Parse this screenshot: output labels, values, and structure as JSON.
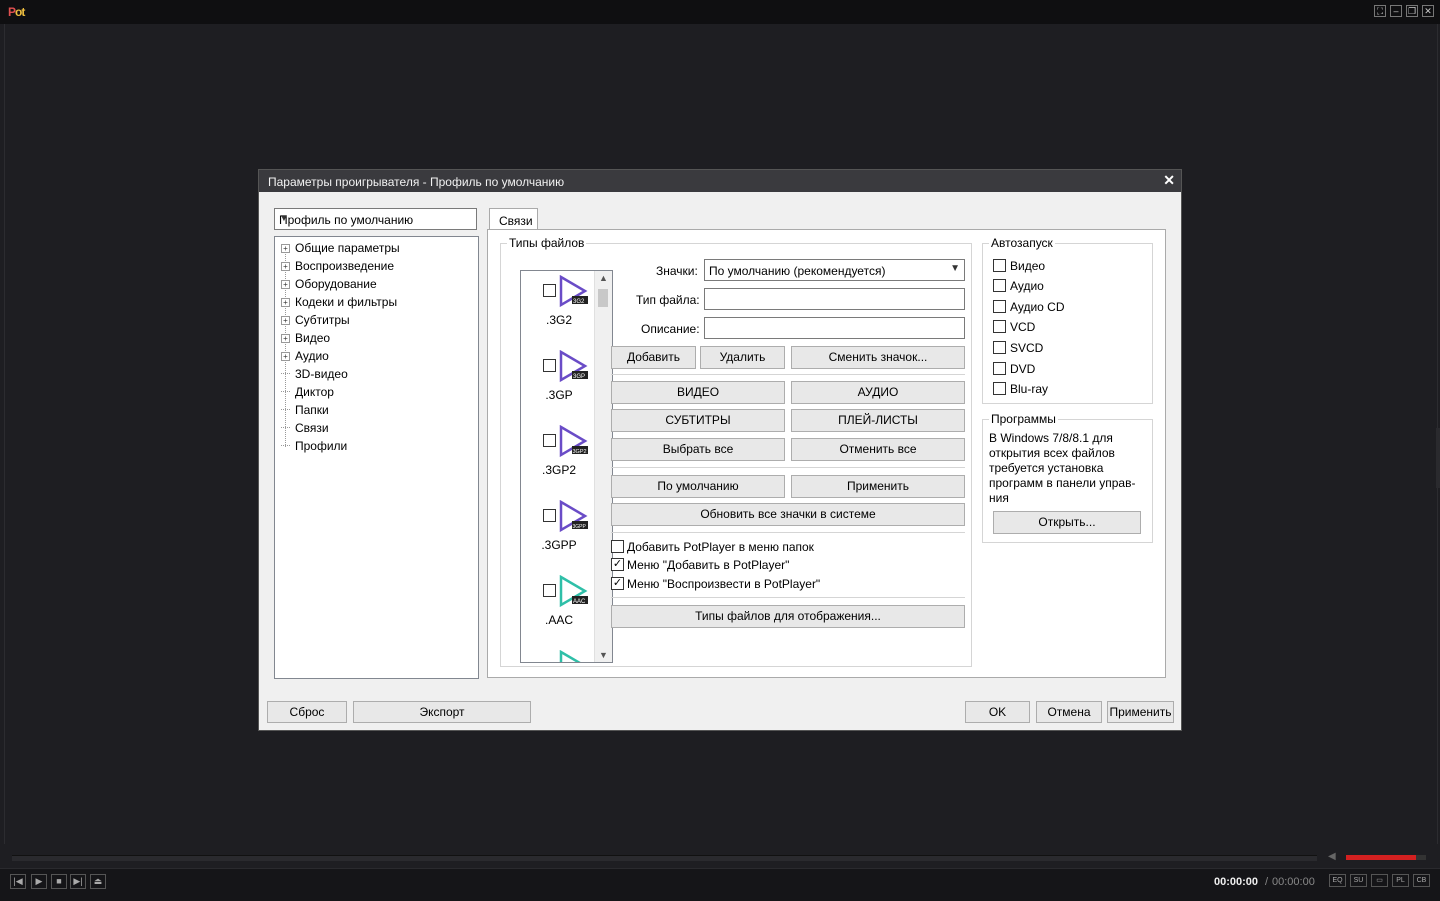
{
  "player": {
    "logo": {
      "prefix": "P",
      "suffix": "o",
      "rest": "t"
    },
    "win_controls": [
      "⛶",
      "–",
      "❐",
      "✕"
    ],
    "time_current": "00:00:00",
    "time_separator": "/",
    "time_total": "00:00:00",
    "mini_buttons": [
      "EQ",
      "SU",
      "▭",
      "PL",
      "CB"
    ],
    "volume_level": 0.88,
    "accent": "#d32020"
  },
  "dialog": {
    "title": "Параметры проигрывателя - Профиль по умолчанию",
    "close": "✕",
    "profile_select": "Профиль по умолчанию",
    "tree": {
      "items": [
        {
          "label": "Общие параметры",
          "expandable": true
        },
        {
          "label": "Воспроизведение",
          "expandable": true
        },
        {
          "label": "Оборудование",
          "expandable": true
        },
        {
          "label": "Кодеки и фильтры",
          "expandable": true
        },
        {
          "label": "Субтитры",
          "expandable": true
        },
        {
          "label": "Видео",
          "expandable": true
        },
        {
          "label": "Аудио",
          "expandable": true
        },
        {
          "label": "3D-видео",
          "expandable": false
        },
        {
          "label": "Диктор",
          "expandable": false
        },
        {
          "label": "Папки",
          "expandable": false
        },
        {
          "label": "Связи",
          "expandable": false
        },
        {
          "label": "Профили",
          "expandable": false
        }
      ]
    },
    "tab": "Связи",
    "file_types": {
      "group_label": "Типы файлов",
      "items": [
        {
          "ext": ".3G2",
          "badge": "3G2",
          "color": "#6a4cc7"
        },
        {
          "ext": ".3GP",
          "badge": "3GP",
          "color": "#6a4cc7"
        },
        {
          "ext": ".3GP2",
          "badge": "3GP2",
          "color": "#6a4cc7"
        },
        {
          "ext": ".3GPP",
          "badge": "3GPP",
          "color": "#6a4cc7"
        },
        {
          "ext": ".AAC",
          "badge": "AAC",
          "color": "#2fbfa8"
        }
      ],
      "icons_label": "Значки:",
      "icons_value": "По умолчанию (рекомендуется)",
      "filetype_label": "Тип файла:",
      "description_label": "Описание:",
      "add_button": "Добавить",
      "remove_button": "Удалить",
      "change_icon_button": "Сменить значок...",
      "video_button": "ВИДЕО",
      "audio_button": "АУДИО",
      "subtitles_button": "СУБТИТРЫ",
      "playlists_button": "ПЛЕЙ-ЛИСТЫ",
      "select_all_button": "Выбрать все",
      "deselect_all_button": "Отменить все",
      "default_button": "По умолчанию",
      "apply_button": "Применить",
      "refresh_icons_button": "Обновить все значки в системе",
      "opt_folder_menu": "Добавить PotPlayer в меню папок",
      "opt_folder_menu_checked": false,
      "opt_add_menu": "Меню \"Добавить в PotPlayer\"",
      "opt_add_menu_checked": true,
      "opt_play_menu": "Меню \"Воспроизвести в PotPlayer\"",
      "opt_play_menu_checked": true,
      "display_types_button": "Типы файлов для отображения..."
    },
    "autorun": {
      "group_label": "Автозапуск",
      "items": [
        "Видео",
        "Аудио",
        "Аудио CD",
        "VCD",
        "SVCD",
        "DVD",
        "Blu-ray"
      ]
    },
    "programs": {
      "group_label": "Программы",
      "text": "В Windows 7/8/8.1 для открытия всех файлов требуется установка программ в панели управ-ния",
      "open_button": "Открыть..."
    },
    "footer": {
      "reset": "Сброс",
      "export": "Экспорт",
      "ok": "OK",
      "cancel": "Отмена",
      "apply": "Применить"
    }
  }
}
